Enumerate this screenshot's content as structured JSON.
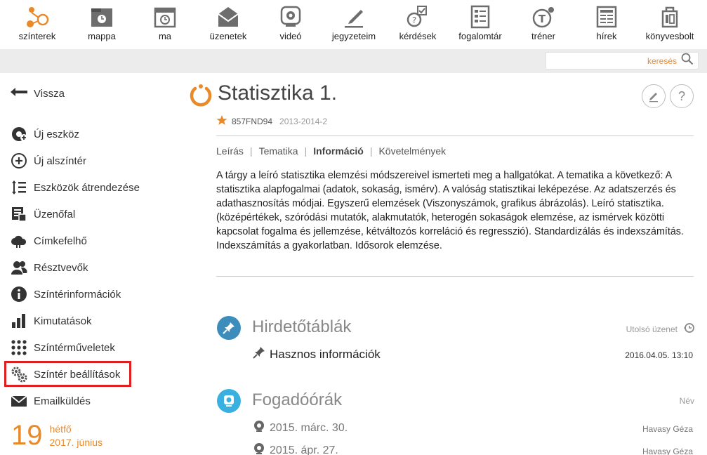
{
  "toolbar": {
    "items": [
      {
        "label": "színterek",
        "icon": "network-icon"
      },
      {
        "label": "mappa",
        "icon": "folder-icon"
      },
      {
        "label": "ma",
        "icon": "calendar-clock-icon"
      },
      {
        "label": "üzenetek",
        "icon": "envelope-icon"
      },
      {
        "label": "videó",
        "icon": "webcam-icon"
      },
      {
        "label": "jegyzeteim",
        "icon": "pencil-icon"
      },
      {
        "label": "kérdések",
        "icon": "quiz-icon"
      },
      {
        "label": "fogalomtár",
        "icon": "glossary-icon"
      },
      {
        "label": "tréner",
        "icon": "trainer-icon"
      },
      {
        "label": "hírek",
        "icon": "newspaper-icon"
      },
      {
        "label": "könyvesbolt",
        "icon": "bookstore-icon"
      }
    ]
  },
  "search": {
    "label": "keresés",
    "placeholder": ""
  },
  "sidebar": {
    "back": "Vissza",
    "items": [
      {
        "label": "Új eszköz",
        "icon": "add-tool-icon"
      },
      {
        "label": "Új alszíntér",
        "icon": "add-circle-icon"
      },
      {
        "label": "Eszközök átrendezése",
        "icon": "reorder-icon"
      },
      {
        "label": "Üzenőfal",
        "icon": "board-icon"
      },
      {
        "label": "Címkefelhő",
        "icon": "cloud-icon"
      },
      {
        "label": "Résztvevők",
        "icon": "users-icon"
      },
      {
        "label": "Színtérinformációk",
        "icon": "info-icon"
      },
      {
        "label": "Kimutatások",
        "icon": "bar-chart-icon"
      },
      {
        "label": "Színtérműveletek",
        "icon": "grid-dots-icon"
      },
      {
        "label": "Színtér beállítások",
        "icon": "gears-icon"
      },
      {
        "label": "Emailküldés",
        "icon": "mail-icon"
      }
    ],
    "date": {
      "day": "19",
      "weekday": "hétfő",
      "yearmonth": "2017. június"
    }
  },
  "course": {
    "title": "Statisztika 1.",
    "code": "857FND94",
    "semester": "2013-2014-2",
    "tabs": [
      "Leírás",
      "Tematika",
      "Információ",
      "Követelmények"
    ],
    "active_tab": "Információ",
    "description": "A tárgy a leíró statisztika elemzési módszereivel ismerteti meg a hallgatókat.  A tematika a következő: A statisztika alapfogalmai (adatok, sokaság, ismérv). A valóság statisztikai leképezése. Az adatszerzés és adathasznosítás módjai. Egyszerű elemzések (Viszonyszámok, grafikus ábrázolás). Leíró statisztika. (középértékek, szóródási mutatók, alakmutatók, heterogén sokaságok elemzése, az ismérvek közötti kapcsolat fogalma és jellemzése, kétváltozós korreláció és regresszió). Standardizálás és indexszámítás. Indexszámítás a gyakorlatban. Idősorok elemzése."
  },
  "board": {
    "title": "Hirdetőtáblák",
    "right_label": "Utolsó üzenet",
    "rows": [
      {
        "text": "Hasznos információk",
        "time": "2016.04.05. 13:10"
      }
    ]
  },
  "office": {
    "title": "Fogadóórák",
    "right_label": "Név",
    "rows": [
      {
        "text": "2015. márc. 30.",
        "name": "Havasy Géza"
      },
      {
        "text": "2015. ápr. 27.",
        "name": "Havasy Géza"
      }
    ]
  },
  "colors": {
    "accent": "#e98a2a",
    "pin_blue": "#3c8dbc",
    "cam_blue": "#3ab0e0",
    "highlight": "#e02020"
  }
}
